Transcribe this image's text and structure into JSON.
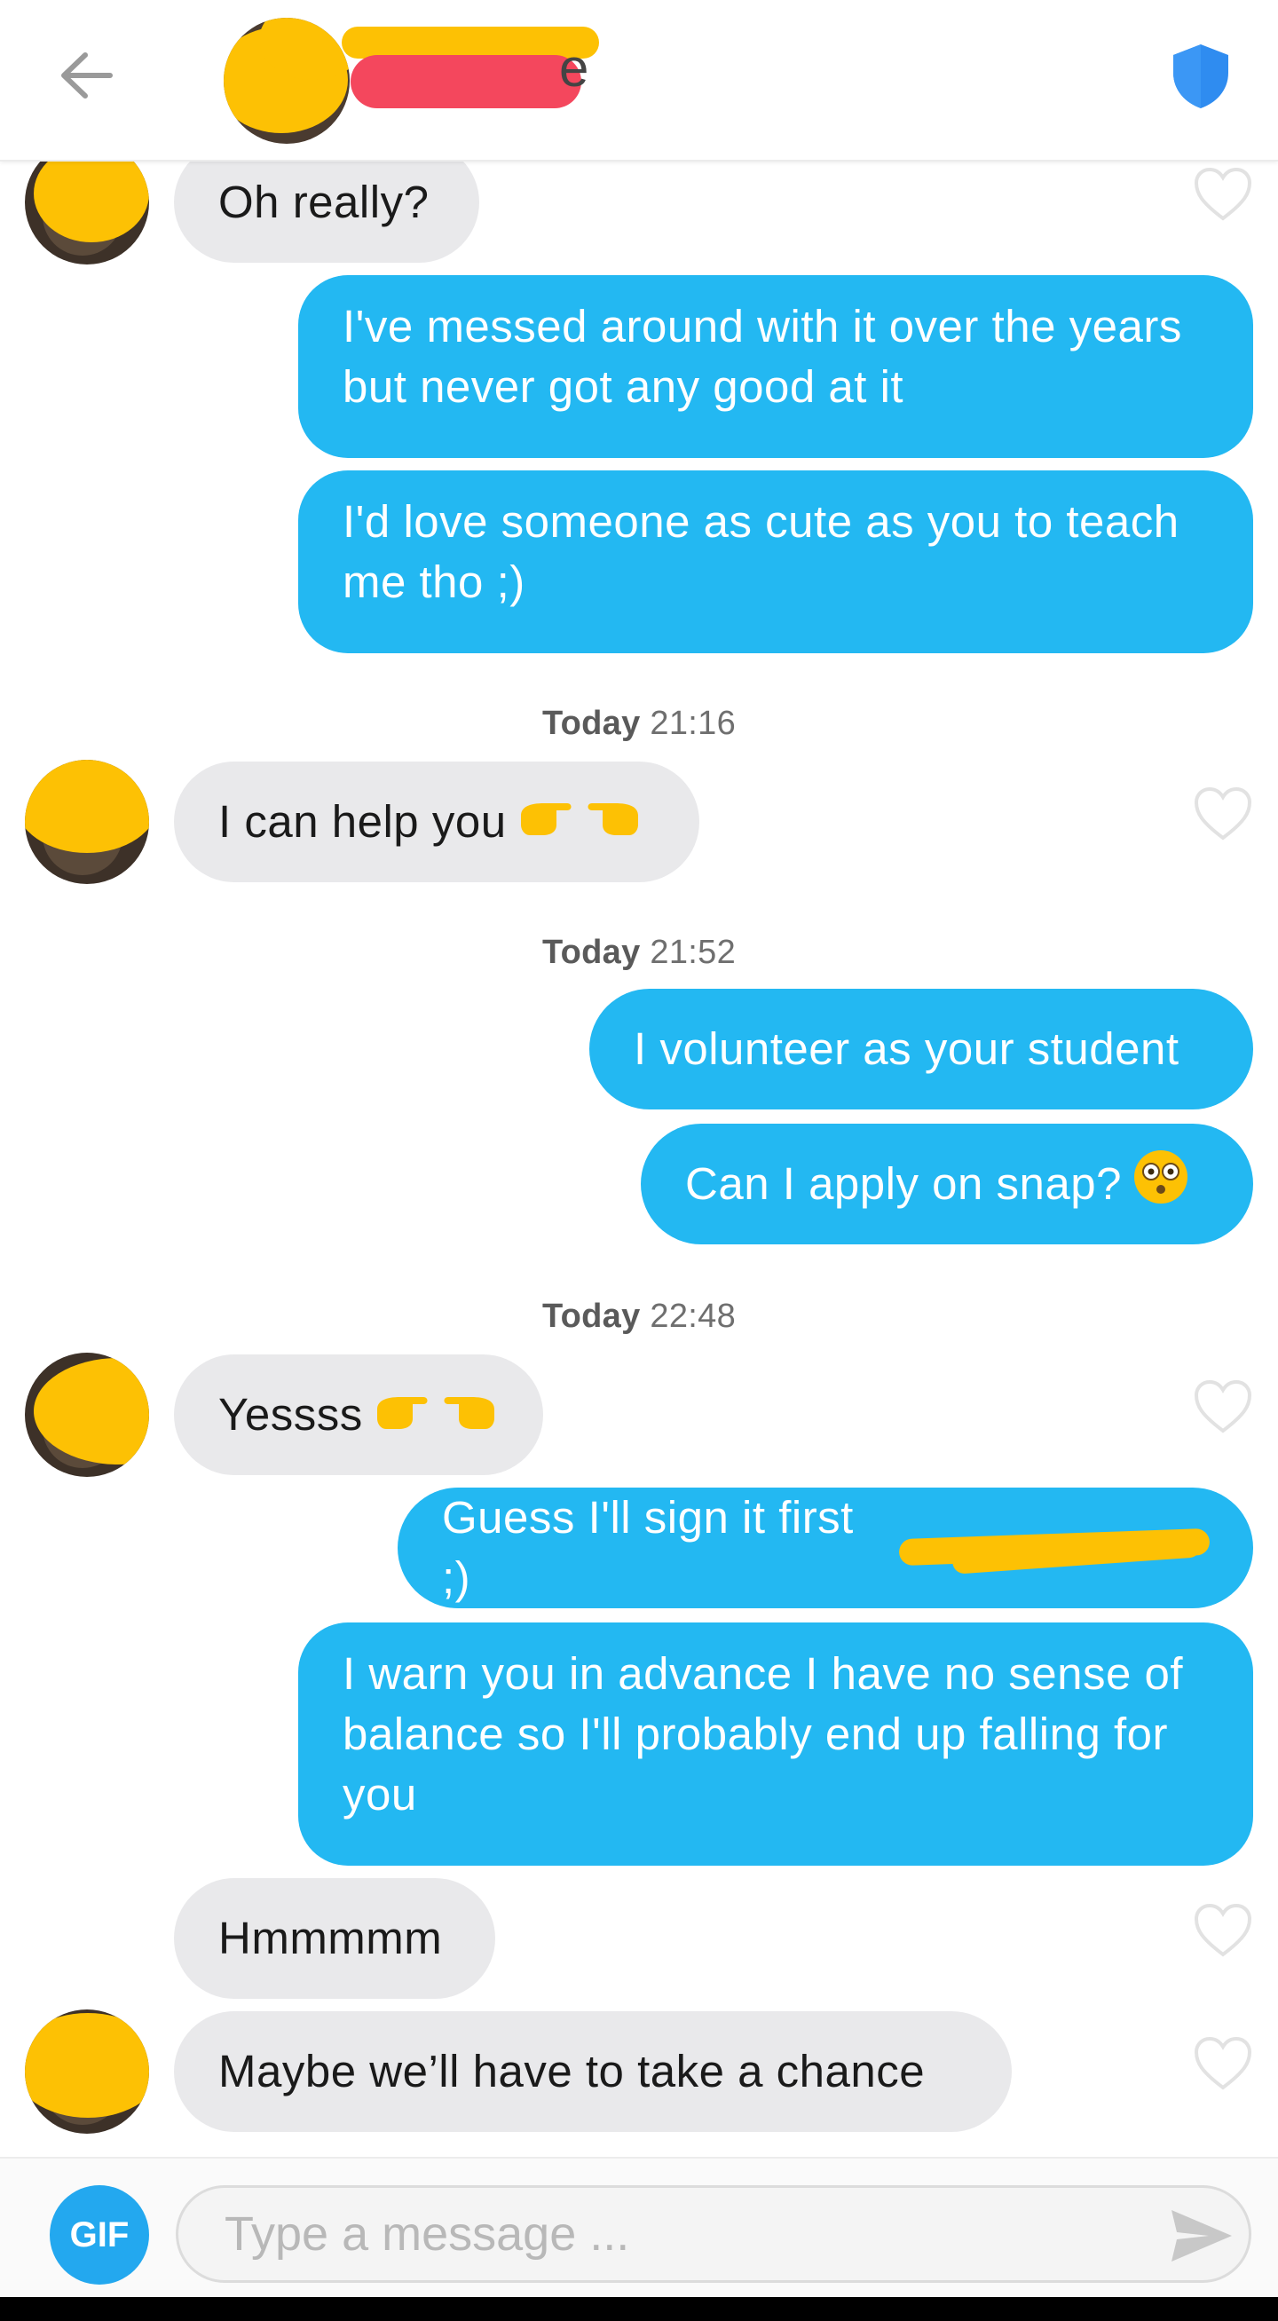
{
  "header": {
    "back_icon": "arrow-left-icon",
    "badge_icon": "shield-icon",
    "badge_color": "#2f8cf0"
  },
  "messages": [
    {
      "side": "in",
      "text": "Oh really?"
    },
    {
      "side": "out",
      "text": "I've messed around with it over the years but never got any good at it"
    },
    {
      "side": "out",
      "text": "I'd love someone as cute as you to teach me tho ;)"
    },
    {
      "type": "timestamp",
      "day": "Today",
      "time": "21:16"
    },
    {
      "side": "in",
      "text": "I can help you",
      "emoji": "👉👈"
    },
    {
      "type": "timestamp",
      "day": "Today",
      "time": "21:52"
    },
    {
      "side": "out",
      "text": "I volunteer as your student"
    },
    {
      "side": "out",
      "text": "Can I apply on snap?",
      "emoji": "😳"
    },
    {
      "type": "timestamp",
      "day": "Today",
      "time": "22:48"
    },
    {
      "side": "in",
      "text": "Yessss",
      "emoji": "👉👈"
    },
    {
      "side": "out",
      "text": "Guess I'll sign it first ;)"
    },
    {
      "side": "out",
      "text": "I warn you in advance I have no sense of balance so I'll probably end up falling for you"
    },
    {
      "side": "in",
      "text": "Hmmmmm"
    },
    {
      "side": "in",
      "text": "Maybe we’ll have to take a chance"
    }
  ],
  "composer": {
    "gif_label": "GIF",
    "placeholder": "Type a message ...",
    "send_icon": "send-icon"
  },
  "colors": {
    "outgoing_bubble": "#23b8f2",
    "incoming_bubble": "#e9e9eb",
    "redaction_yellow": "#fdc104",
    "redaction_red": "#f4475d"
  }
}
